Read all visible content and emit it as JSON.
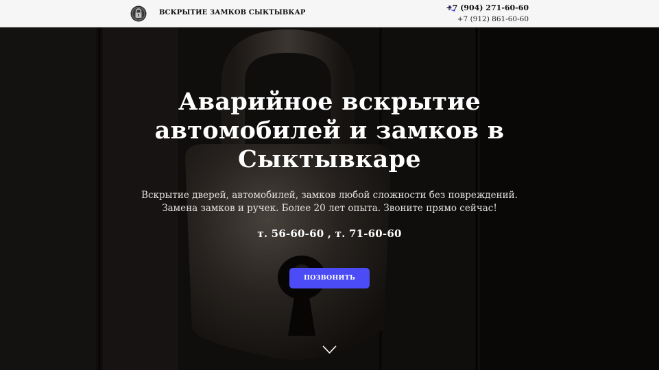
{
  "header": {
    "brand_label": "ВСКРЫТИЕ ЗАМКОВ СЫКТЫВКАР",
    "logo_icon": "padlock-logo-icon",
    "phone_icon": "phone-icon",
    "phone_primary": "+7 (904) 271-60-60",
    "phone_secondary": "+7 (912) 861-60-60"
  },
  "hero": {
    "title_line1": "Аварийное вскрытие",
    "title_line2": "автомобилей и замков в",
    "title_line3": "Сыктывкаре",
    "subtitle_line1": "Вскрытие дверей, автомобилей, замков любой сложности без повреждений.",
    "subtitle_line2": "Замена замков и ручек. Более 20 лет опыта. Звоните прямо сейчас!",
    "phones_text": "т. 56-60-60 , т. 71-60-60",
    "call_button_label": "ПОЗВОНИТЬ",
    "scroll_icon": "chevron-down-icon"
  },
  "colors": {
    "accent": "#4b4cf5",
    "header_bg": "#f6f6f6",
    "hero_text": "#ffffff"
  }
}
